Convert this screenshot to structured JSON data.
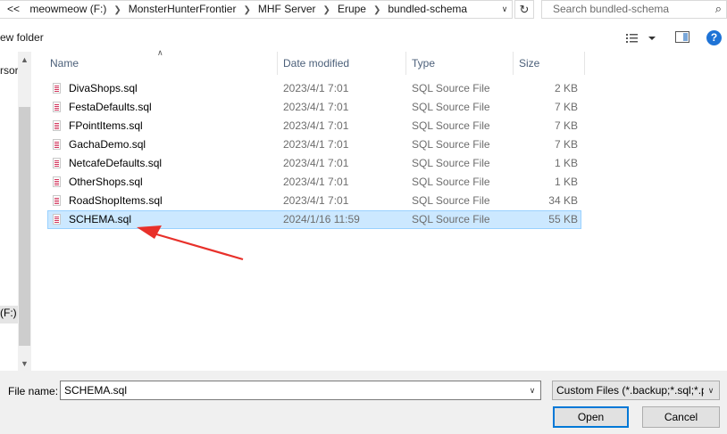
{
  "address_bar": {
    "overflow_label": "<<",
    "breadcrumbs": [
      "meowmeow (F:)",
      "MonsterHunterFrontier",
      "MHF Server",
      "Erupe",
      "bundled-schema"
    ],
    "dropdown_icon": "chevron-down-icon",
    "refresh_icon": "refresh-icon"
  },
  "search": {
    "placeholder": "Search bundled-schema",
    "icon": "search-icon"
  },
  "toolbar": {
    "new_folder_label": "ew folder"
  },
  "nav_pane": {
    "item_partial_1": "rsor",
    "item_partial_2": "(F:)"
  },
  "columns": {
    "name": "Name",
    "date_modified": "Date modified",
    "type": "Type",
    "size": "Size"
  },
  "files": [
    {
      "name": "DivaShops.sql",
      "date": "2023/4/1 7:01",
      "type": "SQL Source File",
      "size": "2 KB"
    },
    {
      "name": "FestaDefaults.sql",
      "date": "2023/4/1 7:01",
      "type": "SQL Source File",
      "size": "7 KB"
    },
    {
      "name": "FPointItems.sql",
      "date": "2023/4/1 7:01",
      "type": "SQL Source File",
      "size": "7 KB"
    },
    {
      "name": "GachaDemo.sql",
      "date": "2023/4/1 7:01",
      "type": "SQL Source File",
      "size": "7 KB"
    },
    {
      "name": "NetcafeDefaults.sql",
      "date": "2023/4/1 7:01",
      "type": "SQL Source File",
      "size": "1 KB"
    },
    {
      "name": "OtherShops.sql",
      "date": "2023/4/1 7:01",
      "type": "SQL Source File",
      "size": "1 KB"
    },
    {
      "name": "RoadShopItems.sql",
      "date": "2023/4/1 7:01",
      "type": "SQL Source File",
      "size": "34 KB"
    },
    {
      "name": "SCHEMA.sql",
      "date": "2024/1/16 11:59",
      "type": "SQL Source File",
      "size": "55 KB",
      "selected": true
    }
  ],
  "bottom": {
    "file_name_label": "File name:",
    "file_name_value": "SCHEMA.sql",
    "filter_value": "Custom Files (*.backup;*.sql;*.p",
    "open_label": "Open",
    "cancel_label": "Cancel"
  },
  "colors": {
    "selection_bg": "#cce8ff",
    "selection_border": "#99d1ff",
    "annotation_arrow": "#e8302a",
    "accent": "#0078d7"
  }
}
